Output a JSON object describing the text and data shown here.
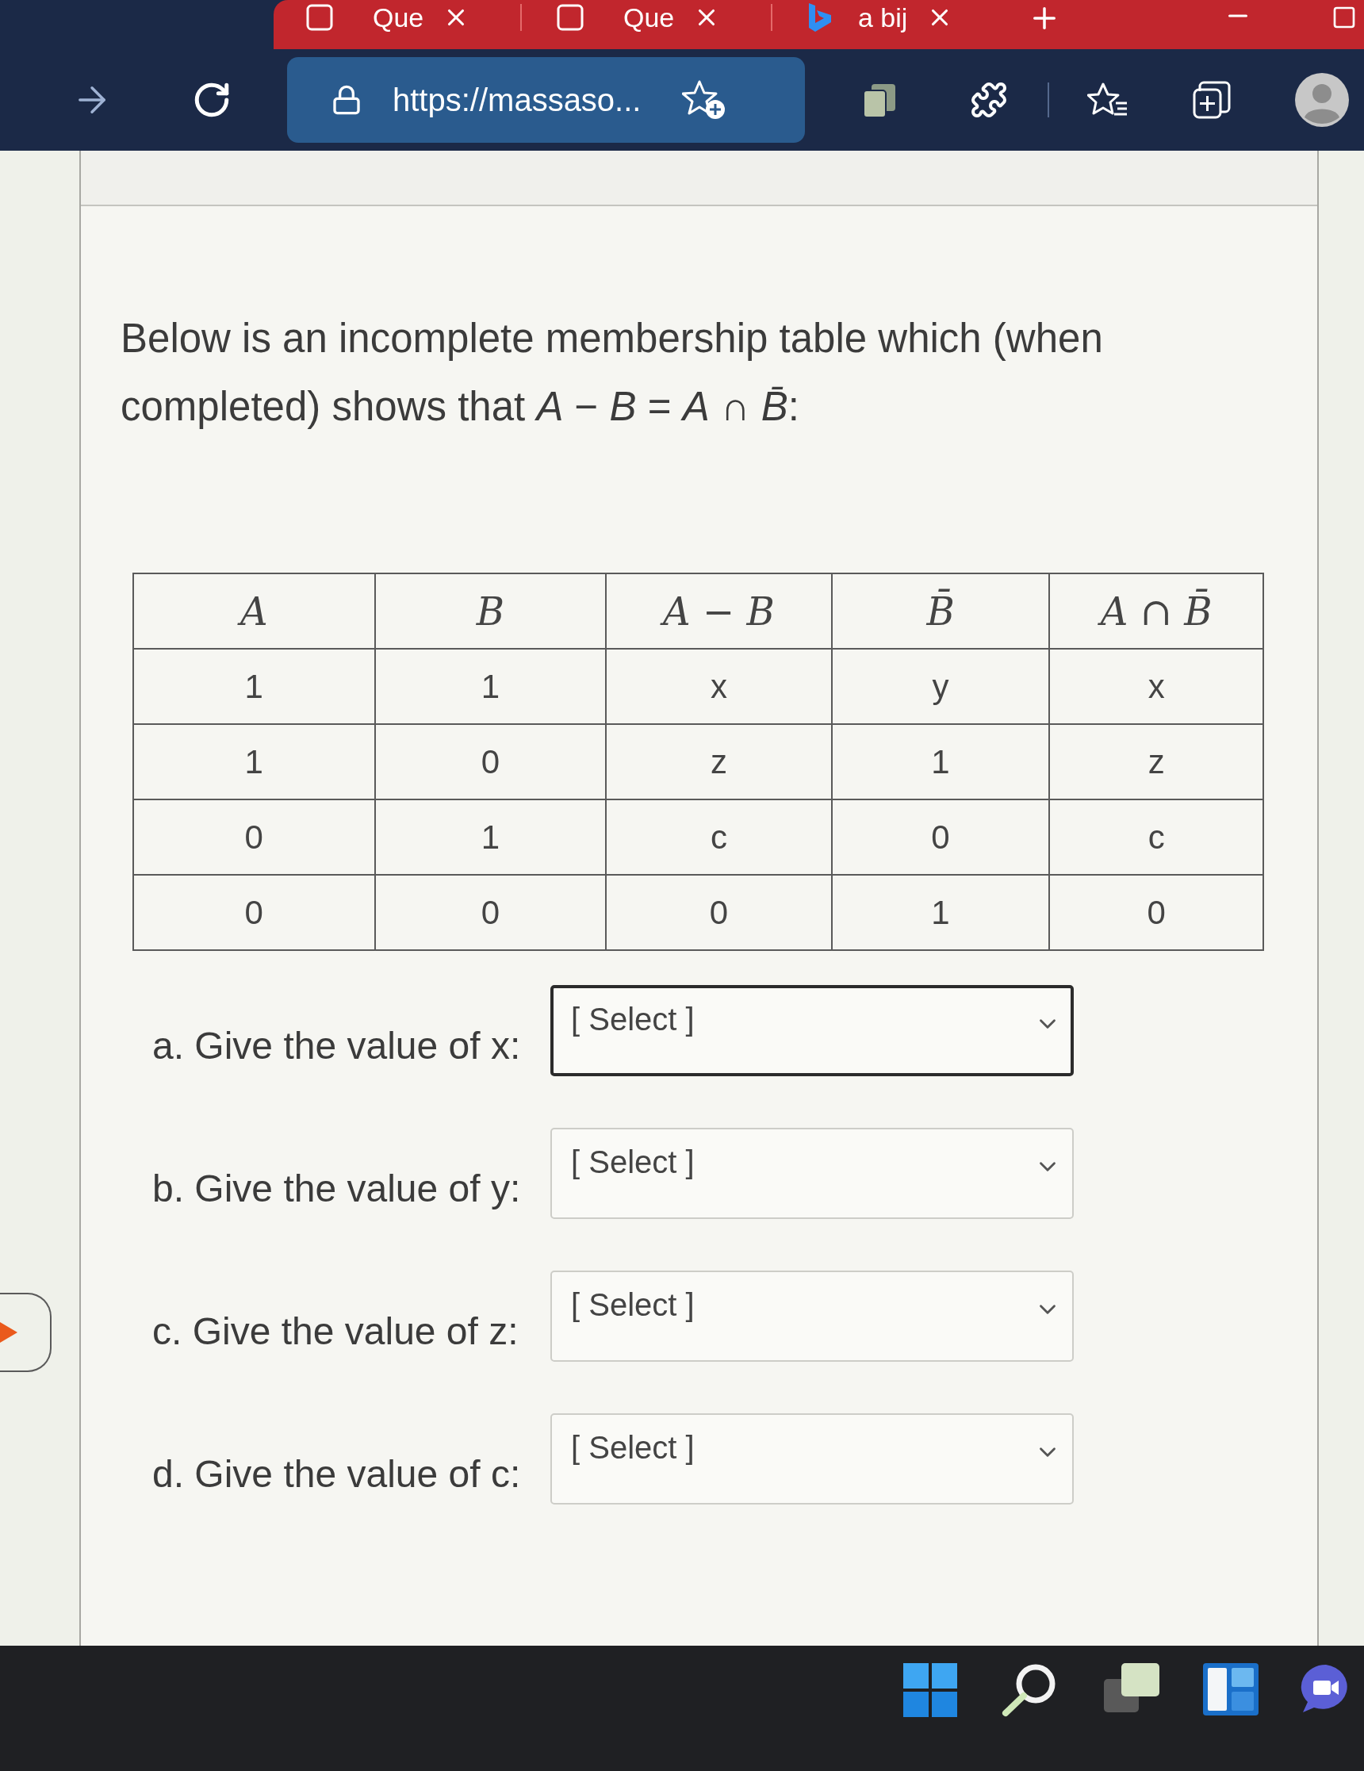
{
  "browser": {
    "tabs": [
      {
        "kind": "document",
        "label": "Que"
      },
      {
        "kind": "document",
        "label": "Que"
      },
      {
        "kind": "logo",
        "label": "a bij"
      }
    ],
    "address_bar": {
      "url": "https://massaso..."
    }
  },
  "question": {
    "text": "Below is an incomplete membership table which (when completed) shows that *A* − *B* = *A* ∩ *B̄*:",
    "table": {
      "columns": [
        "*A*",
        "*B*",
        "*A* − *B*",
        "*B̄*",
        "*A* ∩ *B̄*"
      ],
      "rows": [
        [
          "1",
          "1",
          "x",
          "y",
          "x"
        ],
        [
          "1",
          "0",
          "z",
          "1",
          "z"
        ],
        [
          "0",
          "1",
          "c",
          "0",
          "c"
        ],
        [
          "0",
          "0",
          "0",
          "1",
          "0"
        ]
      ]
    }
  },
  "answers": [
    {
      "label": "a. Give the value of x:",
      "value": "[ Select ]",
      "focused": true
    },
    {
      "label": "b. Give the value of y:",
      "value": "[ Select ]",
      "focused": false
    },
    {
      "label": "c. Give the value of z:",
      "value": "[ Select ]",
      "focused": false
    },
    {
      "label": "d. Give the value of c:",
      "value": "[ Select ]",
      "focused": false
    }
  ]
}
